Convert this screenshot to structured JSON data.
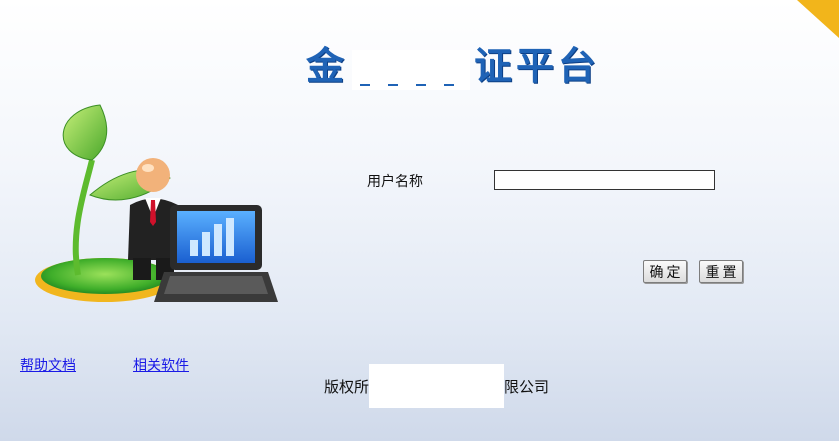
{
  "header": {
    "title_prefix": "金",
    "title_suffix": "证平台"
  },
  "login": {
    "username_label": "用户名称",
    "username_value": "",
    "confirm_label": "确定",
    "reset_label": "重置"
  },
  "links": {
    "help": "帮助文档",
    "related_software": "相关软件"
  },
  "footer": {
    "copyright_prefix": "版权所",
    "copyright_suffix": "限公司"
  },
  "colors": {
    "title": "#1f63b6",
    "link": "#1a1ae6",
    "corner_accent": "#f2b51b"
  },
  "icons": {
    "mascot": "businessman-with-sprout-and-laptop-illustration"
  }
}
